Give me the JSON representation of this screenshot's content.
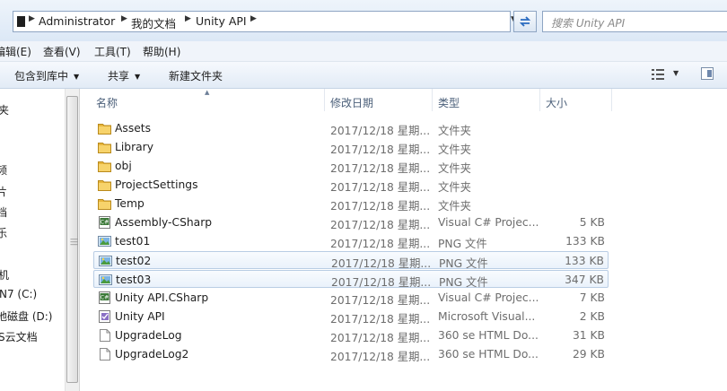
{
  "address_bar": {
    "breadcrumbs": [
      "Administrator",
      "我的文档",
      "Unity API"
    ],
    "search_placeholder": "搜索 Unity API"
  },
  "menu": [
    "编辑(E)",
    "查看(V)",
    "工具(T)",
    "帮助(H)"
  ],
  "toolbar": {
    "include_library": "包含到库中",
    "share": "共享",
    "new_folder": "新建文件夹"
  },
  "nav_pane": {
    "items": [
      "夹",
      "频",
      "片",
      "档",
      "乐",
      "机",
      "N7 (C:)",
      "地磁盘 (D:)",
      "S云文档"
    ]
  },
  "columns": {
    "name": "名称",
    "date": "修改日期",
    "type": "类型",
    "size": "大小"
  },
  "files": [
    {
      "name": "Assets",
      "date": "2017/12/18 星期...",
      "type": "文件夹",
      "size": "",
      "icon": "folder-icon"
    },
    {
      "name": "Library",
      "date": "2017/12/18 星期...",
      "type": "文件夹",
      "size": "",
      "icon": "folder-icon"
    },
    {
      "name": "obj",
      "date": "2017/12/18 星期...",
      "type": "文件夹",
      "size": "",
      "icon": "folder-icon"
    },
    {
      "name": "ProjectSettings",
      "date": "2017/12/18 星期...",
      "type": "文件夹",
      "size": "",
      "icon": "folder-icon"
    },
    {
      "name": "Temp",
      "date": "2017/12/18 星期...",
      "type": "文件夹",
      "size": "",
      "icon": "folder-icon"
    },
    {
      "name": "Assembly-CSharp",
      "date": "2017/12/18 星期...",
      "type": "Visual C# Projec...",
      "size": "5 KB",
      "icon": "csharp-project-icon"
    },
    {
      "name": "test01",
      "date": "2017/12/18 星期...",
      "type": "PNG 文件",
      "size": "133 KB",
      "icon": "png-image-icon"
    },
    {
      "name": "test02",
      "date": "2017/12/18 星期...",
      "type": "PNG 文件",
      "size": "133 KB",
      "icon": "png-image-icon"
    },
    {
      "name": "test03",
      "date": "2017/12/18 星期...",
      "type": "PNG 文件",
      "size": "347 KB",
      "icon": "png-image-icon"
    },
    {
      "name": "Unity API.CSharp",
      "date": "2017/12/18 星期...",
      "type": "Visual C# Projec...",
      "size": "7 KB",
      "icon": "csharp-project-icon"
    },
    {
      "name": "Unity API",
      "date": "2017/12/18 星期...",
      "type": "Microsoft Visual...",
      "size": "2 KB",
      "icon": "visual-studio-solution-icon"
    },
    {
      "name": "UpgradeLog",
      "date": "2017/12/18 星期...",
      "type": "360 se HTML Do...",
      "size": "31 KB",
      "icon": "document-icon"
    },
    {
      "name": "UpgradeLog2",
      "date": "2017/12/18 星期...",
      "type": "360 se HTML Do...",
      "size": "29 KB",
      "icon": "document-icon"
    }
  ],
  "selected_rows": [
    "test02",
    "test03"
  ]
}
